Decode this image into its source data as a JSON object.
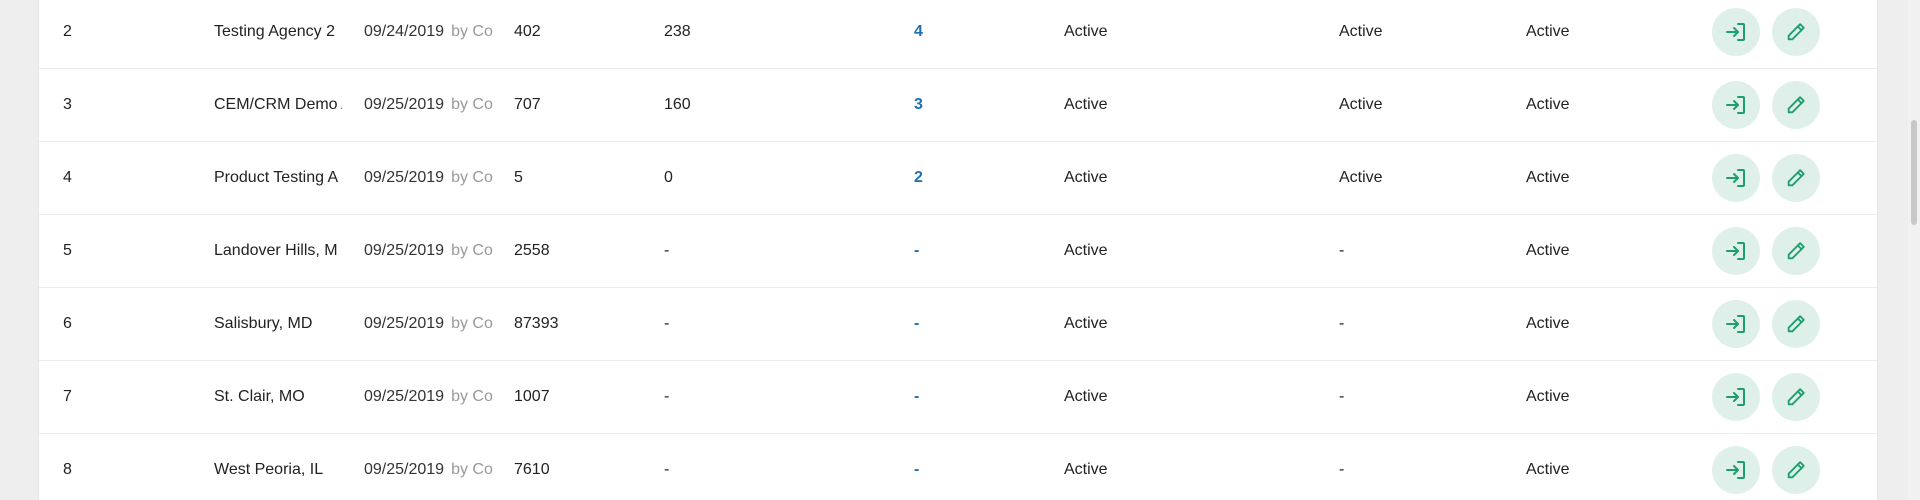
{
  "table": {
    "rows": [
      {
        "id": "2",
        "name": "Testing Agency 2",
        "date": "09/24/2019",
        "by": "by Co",
        "n1": "402",
        "n2": "238",
        "link": "4",
        "status1": "Active",
        "status2": "Active",
        "status3": "Active"
      },
      {
        "id": "3",
        "name": "CEM/CRM Demo A",
        "date": "09/25/2019",
        "by": "by Co",
        "n1": "707",
        "n2": "160",
        "link": "3",
        "status1": "Active",
        "status2": "Active",
        "status3": "Active"
      },
      {
        "id": "4",
        "name": "Product Testing A",
        "date": "09/25/2019",
        "by": "by Co",
        "n1": "5",
        "n2": "0",
        "link": "2",
        "status1": "Active",
        "status2": "Active",
        "status3": "Active"
      },
      {
        "id": "5",
        "name": "Landover Hills, M",
        "date": "09/25/2019",
        "by": "by Co",
        "n1": "2558",
        "n2": "-",
        "link": "-",
        "status1": "Active",
        "status2": "-",
        "status3": "Active"
      },
      {
        "id": "6",
        "name": "Salisbury, MD",
        "date": "09/25/2019",
        "by": "by Co",
        "n1": "87393",
        "n2": "-",
        "link": "-",
        "status1": "Active",
        "status2": "-",
        "status3": "Active"
      },
      {
        "id": "7",
        "name": "St. Clair, MO",
        "date": "09/25/2019",
        "by": "by Co",
        "n1": "1007",
        "n2": "-",
        "link": "-",
        "status1": "Active",
        "status2": "-",
        "status3": "Active"
      },
      {
        "id": "8",
        "name": "West Peoria, IL",
        "date": "09/25/2019",
        "by": "by Co",
        "n1": "7610",
        "n2": "-",
        "link": "-",
        "status1": "Active",
        "status2": "-",
        "status3": "Active"
      }
    ],
    "actions": {
      "login_icon": "login-icon",
      "edit_icon": "pencil-icon"
    }
  },
  "colors": {
    "link": "#1f6fb2",
    "action_bg": "#dff0ea",
    "action_icon": "#1e9e6e"
  }
}
